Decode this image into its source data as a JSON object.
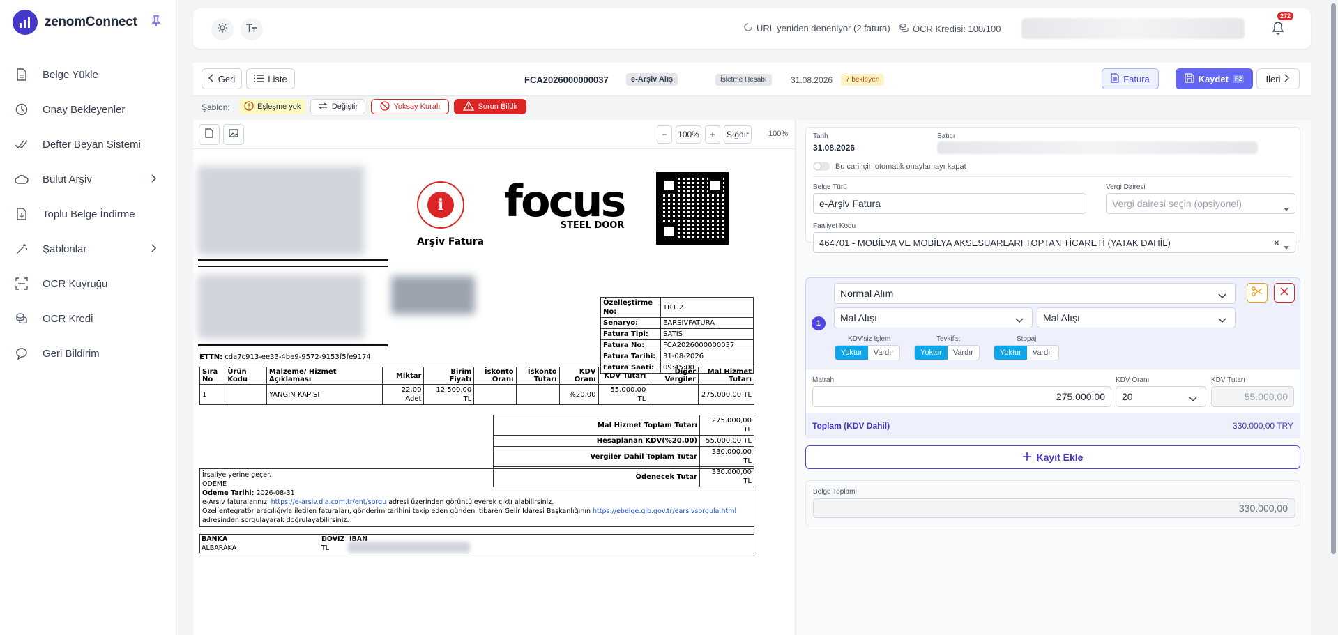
{
  "app": {
    "title": "zenomConnect"
  },
  "sidebar": {
    "items": [
      {
        "label": "Belge Yükle",
        "icon": "file-upload-icon"
      },
      {
        "label": "Onay Bekleyenler",
        "icon": "clock-icon"
      },
      {
        "label": "Defter Beyan Sistemi",
        "icon": "check-double-icon"
      },
      {
        "label": "Bulut Arşiv",
        "icon": "cloud-icon"
      },
      {
        "label": "Toplu Belge İndirme",
        "icon": "file-download-icon"
      },
      {
        "label": "Şablonlar",
        "icon": "magic-wand-icon"
      },
      {
        "label": "OCR Kuyruğu",
        "icon": "scan-icon"
      },
      {
        "label": "OCR Kredi",
        "icon": "coins-icon"
      },
      {
        "label": "Geri Bildirim",
        "icon": "chat-icon"
      }
    ]
  },
  "topbar": {
    "retry_text": "URL yeniden deneniyor (2 fatura)",
    "ocr_credit": "OCR Kredisi: 100/100",
    "notification_count": "272"
  },
  "docbar": {
    "back": "Geri",
    "list": "Liste",
    "doc_no": "FCA2026000000037",
    "doc_type": "e-Arşiv Alış",
    "account": "İşletme Hesabı",
    "date": "31.08.2026",
    "pending": "7 bekleyen",
    "invoice_btn": "Fatura",
    "save_btn": "Kaydet",
    "save_key": "F2",
    "next_btn": "İleri"
  },
  "template": {
    "label": "Şablon:",
    "match": "Eşleşme yok",
    "change": "Değiştir",
    "ignore": "Yoksay Kuralı",
    "report": "Sorun Bildir"
  },
  "preview": {
    "zoom": "100%",
    "fit": "Sığdır",
    "zoom_right": "100%"
  },
  "invoice": {
    "title": "Arşiv Fatura",
    "brand_main": "focus",
    "brand_sub": "STEEL DOOR",
    "ettn_label": "ETTN:",
    "ettn": "cda7c913-ee33-4be9-9572-9153f5fe9174",
    "meta": [
      {
        "k": "Özelleştirme No:",
        "v": "TR1.2"
      },
      {
        "k": "Senaryo:",
        "v": "EARSIVFATURA"
      },
      {
        "k": "Fatura Tipi:",
        "v": "SATIS"
      },
      {
        "k": "Fatura No:",
        "v": "FCA2026000000037"
      },
      {
        "k": "Fatura Tarihi:",
        "v": "31-08-2026"
      },
      {
        "k": "Fatura Saati:",
        "v": "09:45:00"
      }
    ],
    "headers": [
      "Sıra No",
      "Ürün Kodu",
      "Malzeme/ Hizmet Açıklaması",
      "Miktar",
      "Birim Fiyatı",
      "İskonto Oranı",
      "İskonto Tutarı",
      "KDV Oranı",
      "KDV Tutarı",
      "Diğer Vergiler",
      "Mal Hizmet Tutarı"
    ],
    "row": [
      "1",
      "",
      "YANGIN KAPISI",
      "22,00 Adet",
      "12.500,00 TL",
      "",
      "",
      "%20,00",
      "55.000,00 TL",
      "",
      "275.000,00 TL"
    ],
    "totals": [
      {
        "k": "Mal Hizmet Toplam Tutarı",
        "v": "275.000,00 TL"
      },
      {
        "k": "Hesaplanan KDV(%20.00)",
        "v": "55.000,00 TL"
      },
      {
        "k": "Vergiler Dahil Toplam Tutar",
        "v": "330.000,00 TL"
      },
      {
        "k": "Ödenecek Tutar",
        "v": "330.000,00 TL"
      }
    ],
    "note1": "İrsaliye yerine geçer.",
    "note2": "ÖDEME",
    "pay_label": "Ödeme Tarihi:",
    "pay_date": " 2026-08-31",
    "note3a": "e-Arşiv faturalarınızı ",
    "link1": "https://e-arsiv.dia.com.tr/ent/sorgu",
    "note3b": " adresi üzerinden görüntüleyerek çıktı alabilirsiniz.",
    "note4a": "Özel entegratör aracılığıyla iletilen faturaları, gönderim tarihini takip eden günden itibaren Gelir İdaresi Başkanlığının ",
    "link2": "https://ebelge.gib.gov.tr/earsivsorgula.html",
    "note4b": "adresinden sorgulayarak doğrulayabilirsiniz.",
    "bank_h": [
      "BANKA",
      "DÖVİZ",
      "IBAN"
    ],
    "bank_r": [
      "ALBARAKA",
      "TL"
    ]
  },
  "form": {
    "date_label": "Tarih",
    "date": "31.08.2026",
    "seller_label": "Satıcı",
    "auto_approve": "Bu cari için otomatik onaylamayı kapat",
    "doc_type_label": "Belge Türü",
    "doc_type": "e-Arşiv Fatura",
    "tax_office_label": "Vergi Dairesi",
    "tax_office_placeholder": "Vergi dairesi seçin (opsiyonel)",
    "activity_label": "Faaliyet Kodu",
    "activity": "464701 - MOBİLYA VE MOBİLYA AKSESUARLARI TOPTAN TİCARETİ (YATAK DAHİL)",
    "line": {
      "no": "1",
      "purchase_type": "Normal Alım",
      "account1": "Mal Alışı",
      "account2": "Mal Alışı",
      "kdv_free_label": "KDV'siz İşlem",
      "tevkifat_label": "Tevkifat",
      "stopaj_label": "Stopaj",
      "no_opt": "Yoktur",
      "yes_opt": "Vardır",
      "matrah_label": "Matrah",
      "matrah": "275.000,00",
      "kdv_rate_label": "KDV Oranı",
      "kdv_rate": "20",
      "kdv_amount_label": "KDV Tutarı",
      "kdv_amount": "55.000,00",
      "total_label": "Toplam (KDV Dahil)",
      "total": "330.000,00 TRY"
    },
    "add_record": "Kayıt Ekle",
    "doc_total_label": "Belge Toplamı",
    "doc_total": "330.000,00"
  },
  "colors": {
    "accent": "#4f46e5",
    "danger": "#dc2626",
    "info": "#0ea5e9",
    "purple_bg": "#eef0fb"
  }
}
